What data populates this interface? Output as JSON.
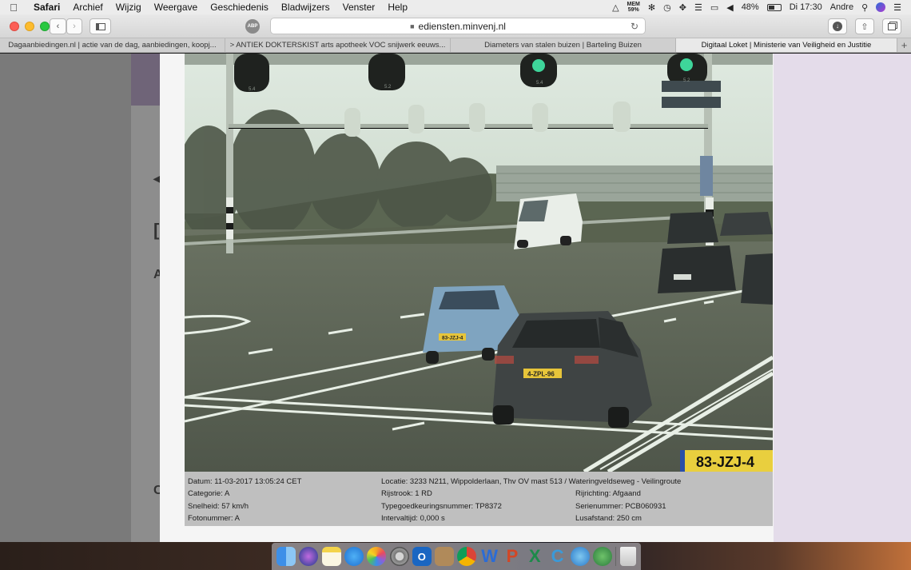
{
  "menubar": {
    "apple": "",
    "items": [
      "Safari",
      "Archief",
      "Wijzig",
      "Weergave",
      "Geschiedenis",
      "Bladwijzers",
      "Venster",
      "Help"
    ],
    "mem_label": "MEM",
    "mem_value": "59%",
    "battery": "48%",
    "battery_level": 0.48,
    "clock": "Di 17:30",
    "user": "Andre"
  },
  "toolbar": {
    "url": "ediensten.minvenj.nl",
    "abp_label": "ABP"
  },
  "tabs": [
    "Dagaanbiedingen.nl | actie van de dag, aanbiedingen, koopj...",
    "> ANTIEK DOKTERSKIST arts apotheek VOC snijwerk eeuws...",
    "Diameters van stalen buizen | Barteling Buizen",
    "Digitaal Loket | Ministerie van Veiligheid en Justitie"
  ],
  "photo": {
    "plate_overlay": "83-JZJ-4",
    "car_plate_1": "83-JZJ-4",
    "car_plate_2": "4-ZPL-96",
    "signal_labels": [
      "5.4",
      "5.2",
      "5.4",
      "5.2"
    ]
  },
  "info": {
    "datum": "Datum: 11-03-2017 13:05:24 CET",
    "categorie": "Categorie: A",
    "snelheid": "Snelheid: 57 km/h",
    "fotonummer": "Fotonummer: A",
    "locatie": "Locatie: 3233 N211, Wippolderlaan, Thv OV mast 513 / Wateringveldseweg - Veilingroute",
    "rijstrook": "Rijstrook: 1 RD",
    "typegoedkeuring": "Typegoedkeuringsnummer: TP8372",
    "intervaltijd": "Intervaltijd: 0,000 s",
    "rijrichting": "Rijrichting: Afgaand",
    "serienummer": "Serienummer: PCB060931",
    "lusafstand": "Lusafstand: 250 cm"
  },
  "dock": {
    "icons": [
      "finder-icon",
      "siri-icon",
      "notes-icon",
      "safari-icon",
      "photos-icon",
      "system-preferences-icon",
      "outlook-icon",
      "contacts-icon",
      "chrome-icon",
      "word-icon",
      "powerpoint-icon",
      "excel-icon",
      "cyberduck-icon",
      "teamviewer-icon",
      "maps-icon",
      "trash-icon"
    ],
    "letters": [
      "W",
      "P",
      "X",
      "C"
    ]
  },
  "colors": {
    "traffic_red": "#fc5f57",
    "traffic_yellow": "#fdbc2e",
    "traffic_green": "#28c840",
    "side_panel": "#e4dcea"
  }
}
